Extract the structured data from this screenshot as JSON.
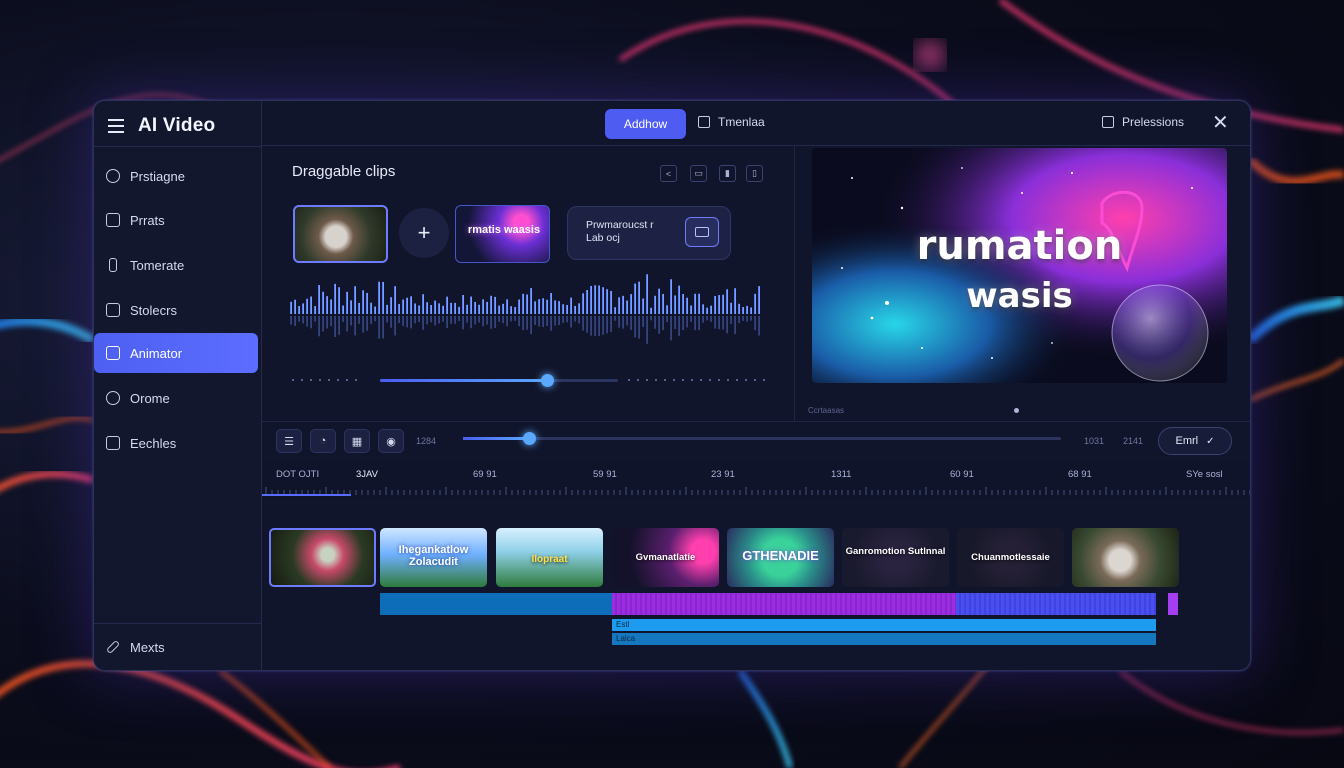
{
  "app": {
    "title": "AI Video"
  },
  "topbar": {
    "primary_button": "Addhow",
    "timeline_label": "Tmenlaa",
    "permissions_label": "Prelessions"
  },
  "sidebar": {
    "items": [
      {
        "label": "Prstiagne",
        "icon": "gear-icon",
        "active": false
      },
      {
        "label": "Prrats",
        "icon": "document-icon",
        "active": false
      },
      {
        "label": "Tomerate",
        "icon": "text-icon",
        "active": false
      },
      {
        "label": "Stolecrs",
        "icon": "folder-icon",
        "active": false
      },
      {
        "label": "Animator",
        "icon": "animator-icon",
        "active": true
      },
      {
        "label": "Orome",
        "icon": "circle-icon",
        "active": false
      },
      {
        "label": "Eechles",
        "icon": "layers-icon",
        "active": false
      }
    ],
    "bottom_item": {
      "label": "Mexts",
      "icon": "pencil-icon"
    }
  },
  "editor": {
    "title": "Draggable clips",
    "slider_value": 0.7,
    "clip_thumb_text": "rmatis waasis",
    "clip_card_line1": "Prwmaroucst r",
    "clip_card_line2": "Lab ocj"
  },
  "preview": {
    "headline_line1": "rumation",
    "headline_line2": "wasis",
    "caption": "Ccrtaasas"
  },
  "transport": {
    "time_left": "1284",
    "time_right_a": "1031",
    "time_right_b": "2141",
    "emit_label": "Emrl",
    "scrub_value": 0.11
  },
  "ruler": {
    "labels": [
      "DOT OJTI",
      "3JAV",
      "69 91",
      "59 91",
      "23 91",
      "1311",
      "60 91",
      "68 91",
      "SYe sosl"
    ],
    "cursor_value": 0.09
  },
  "clips": [
    {
      "caption": "",
      "selected": true
    },
    {
      "caption": "Ihegankatlow Zolacudit",
      "selected": false
    },
    {
      "caption": "Ilopraat",
      "selected": false
    },
    {
      "caption": "Gvmanatlatie",
      "selected": false
    },
    {
      "caption": "GTHENADIE",
      "selected": false
    },
    {
      "caption": "Ganromotion Sutlnnal",
      "selected": false
    },
    {
      "caption": "Chuanmotlessaie",
      "selected": false
    },
    {
      "caption": "",
      "selected": false
    }
  ],
  "tracks": {
    "sub1": "Estl",
    "sub2": "Lalca"
  },
  "colors": {
    "accent": "#5563f5",
    "active_nav": "#5060f2",
    "track_blue": "#0e6db8",
    "track_purple": "#9a2ee0",
    "track_indigo": "#4b4ff0",
    "subtrack_cyan": "#1d9bef"
  }
}
